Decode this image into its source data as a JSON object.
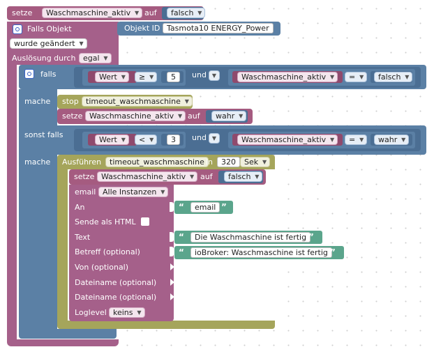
{
  "blocks": {
    "set_kw": "setze",
    "auf_kw": "auf",
    "var_name": "Waschmaschine_aktiv",
    "falsch_value": "falsch",
    "wahr_value": "wahr",
    "trigger_label": "Falls Objekt",
    "object_id_label": "Objekt ID",
    "object_id_value": "Tasmota10 ENERGY_Power",
    "trigger_mode": "wurde geändert",
    "ausloesung_label": "Auslösung durch",
    "ausloesung_value": "egal",
    "if_label": "falls",
    "do_label": "mache",
    "elseif_label": "sonst falls",
    "and_label": "und",
    "wert_label": "Wert",
    "op_ge": "≥",
    "op_lt": "<",
    "op_eq": "=",
    "num_5": "5",
    "num_3": "3",
    "stop_kw": "stop",
    "timeout_name": "timeout_waschmaschine",
    "exec_kw": "Ausführen",
    "in_kw": "in",
    "delay_value": "320",
    "delay_unit": "Sek",
    "email_label": "email",
    "email_instance": "Alle Instanzen",
    "an_label": "An",
    "an_value": "email",
    "html_label": "Sende als HTML",
    "text_label": "Text",
    "text_value": "Die Waschmaschine ist fertig",
    "betreff_label": "Betreff (optional)",
    "betreff_value": "ioBroker: Waschmaschine ist fertig",
    "von_label": "Von (optional)",
    "dateiname_label": "Dateiname (optional)",
    "loglevel_label": "Loglevel",
    "loglevel_value": "keins"
  },
  "icons": {
    "settings": "gear-icon",
    "dropdown": "triangle-down-icon",
    "quote_open": "“",
    "quote_close": "”",
    "arrow": "▾"
  },
  "colors": {
    "variables": "#a55b80",
    "logic": "#5b80a5",
    "timeouts": "#a5a55b",
    "text": "#5ba58c",
    "trigger": "#a5608a"
  }
}
